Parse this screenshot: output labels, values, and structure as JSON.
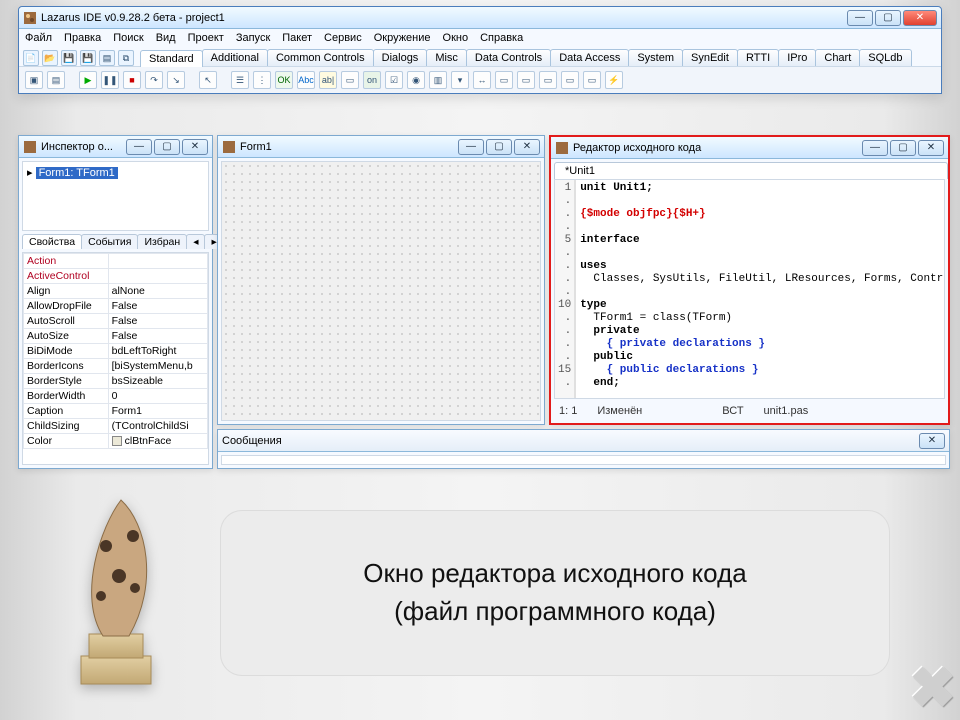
{
  "ide": {
    "title": "Lazarus IDE v0.9.28.2 бета - project1",
    "menus": [
      "Файл",
      "Правка",
      "Поиск",
      "Вид",
      "Проект",
      "Запуск",
      "Пакет",
      "Сервис",
      "Окружение",
      "Окно",
      "Справка"
    ],
    "tabs": [
      "Standard",
      "Additional",
      "Common Controls",
      "Dialogs",
      "Misc",
      "Data Controls",
      "Data Access",
      "System",
      "SynEdit",
      "RTTI",
      "IPro",
      "Chart",
      "SQLdb"
    ],
    "active_tab": "Standard"
  },
  "inspector": {
    "title": "Инспектор о...",
    "tree_item": "Form1: TForm1",
    "prop_tabs": [
      "Свойства",
      "События",
      "Избран"
    ],
    "properties": [
      {
        "name": "Action",
        "value": ""
      },
      {
        "name": "ActiveControl",
        "value": ""
      },
      {
        "name": "Align",
        "value": "alNone"
      },
      {
        "name": "AllowDropFile",
        "value": "False"
      },
      {
        "name": "AutoScroll",
        "value": "False"
      },
      {
        "name": "AutoSize",
        "value": "False"
      },
      {
        "name": "BiDiMode",
        "value": "bdLeftToRight"
      },
      {
        "name": "BorderIcons",
        "value": "[biSystemMenu,b"
      },
      {
        "name": "BorderStyle",
        "value": "bsSizeable"
      },
      {
        "name": "BorderWidth",
        "value": "0"
      },
      {
        "name": "Caption",
        "value": "Form1"
      },
      {
        "name": "ChildSizing",
        "value": "(TControlChildSi"
      },
      {
        "name": "Color",
        "value": "clBtnFace"
      }
    ]
  },
  "designer": {
    "title": "Form1"
  },
  "editor": {
    "title": "Редактор исходного кода",
    "tab": "*Unit1",
    "gutter": [
      "1",
      ".",
      ".",
      ".",
      "5",
      ".",
      ".",
      ".",
      ".",
      "10",
      ".",
      ".",
      ".",
      ".",
      "15",
      "."
    ],
    "code_plain": [
      {
        "t": "unit Unit1;",
        "cls": "kw"
      },
      {
        "t": "",
        "cls": ""
      },
      {
        "t": "{$mode objfpc}{$H+}",
        "cls": "dir"
      },
      {
        "t": "",
        "cls": ""
      },
      {
        "t": "interface",
        "cls": "kw"
      },
      {
        "t": "",
        "cls": ""
      },
      {
        "t": "uses",
        "cls": "kw"
      },
      {
        "t": "  Classes, SysUtils, FileUtil, LResources, Forms, Contr",
        "cls": ""
      },
      {
        "t": "",
        "cls": ""
      },
      {
        "t": "type",
        "cls": "kw"
      },
      {
        "t": "  TForm1 = class(TForm)",
        "cls": ""
      },
      {
        "t": "  private",
        "cls": "kw"
      },
      {
        "t": "    { private declarations }",
        "cls": "cmt"
      },
      {
        "t": "  public",
        "cls": "kw"
      },
      {
        "t": "    { public declarations }",
        "cls": "cmt"
      },
      {
        "t": "  end;",
        "cls": "kw"
      }
    ],
    "status": {
      "pos": "1:  1",
      "state": "Изменён",
      "ins": "ВСТ",
      "file": "unit1.pas"
    }
  },
  "messages": {
    "title": "Сообщения"
  },
  "caption": {
    "line1": "Окно редактора исходного кода",
    "line2": "(файл программного кода)"
  }
}
